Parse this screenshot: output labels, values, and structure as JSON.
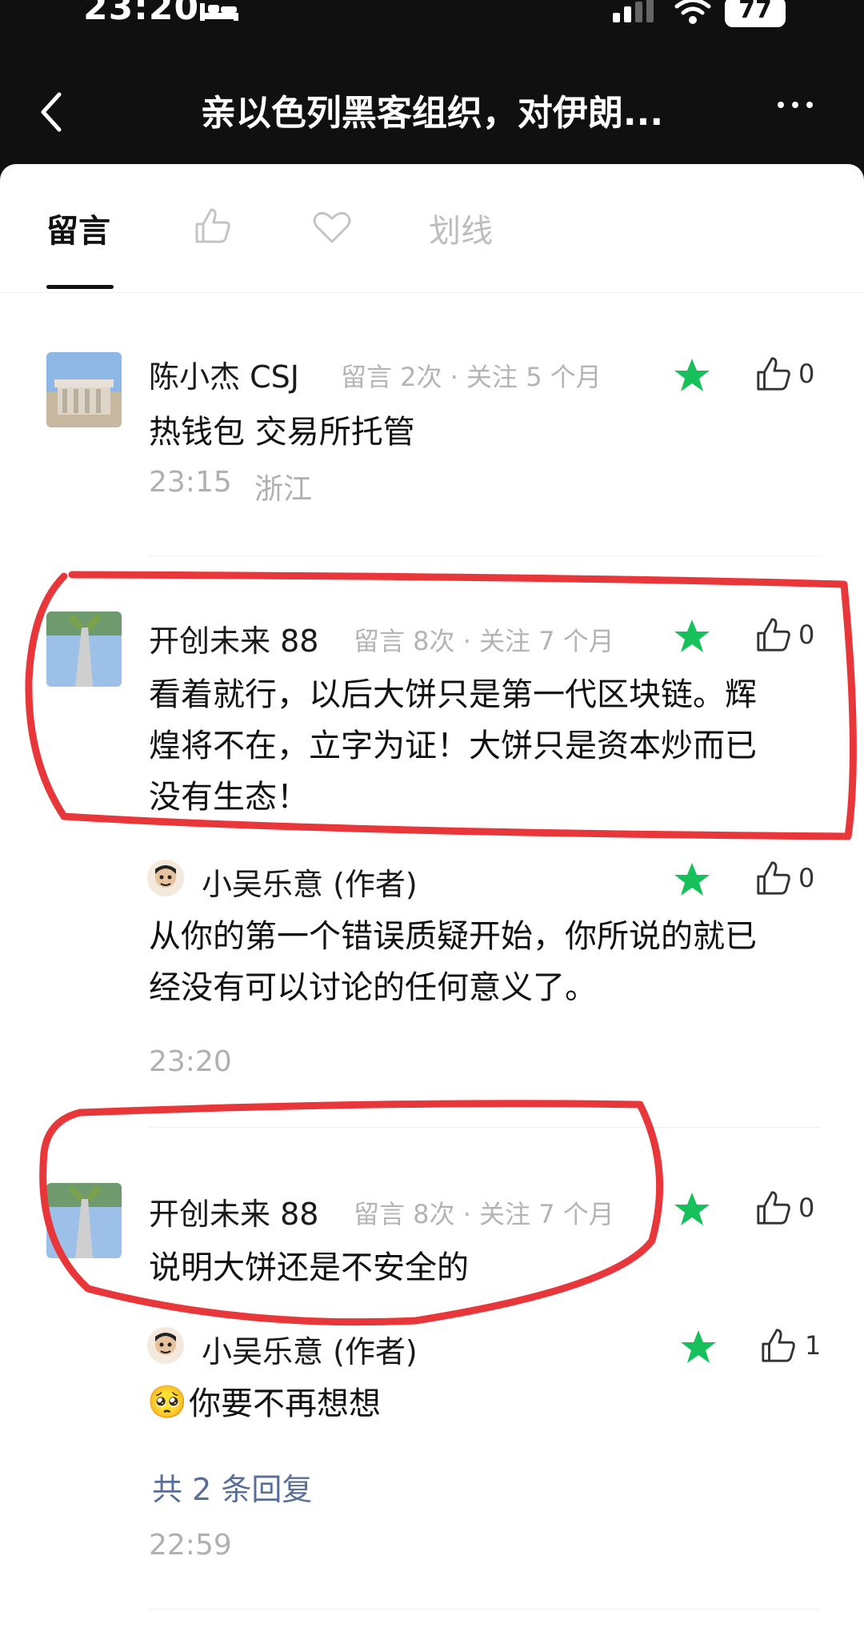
{
  "status": {
    "time": "23:20",
    "battery": "77"
  },
  "nav": {
    "title": "亲以色列黑客组织，对伊朗..."
  },
  "tabs": [
    {
      "label": "留言"
    },
    {
      "icon": "thumbs-up-icon"
    },
    {
      "icon": "heart-icon"
    },
    {
      "label": "划线"
    }
  ],
  "comments": [
    {
      "author": "陈小杰 CSJ",
      "meta": "留言 2次 · 关注 5 个月",
      "text": "热钱包 交易所托管",
      "time": "23:15",
      "location": "浙江",
      "likes": "0"
    },
    {
      "author": "开创未来 88",
      "meta": "留言 8次 · 关注 7 个月",
      "text_lines": [
        "看着就行，以后大饼只是第一代区块链。辉",
        "煌将不在，立字为证！大饼只是资本炒而已",
        "没有生态！"
      ],
      "likes": "0",
      "reply": {
        "author": "小吴乐意 (作者)",
        "text_lines": [
          "从你的第一个错误质疑开始，你所说的就已",
          "经没有可以讨论的任何意义了。"
        ],
        "likes": "0"
      },
      "time": "23:20"
    },
    {
      "author": "开创未来 88",
      "meta": "留言 8次 · 关注 7 个月",
      "text": "说明大饼还是不安全的",
      "likes": "0",
      "reply": {
        "author": "小吴乐意 (作者)",
        "emoji": "🥺",
        "text": "你要不再想想",
        "likes": "1"
      },
      "reply_count": "共 2 条回复",
      "time": "22:59"
    }
  ],
  "colors": {
    "star": "#17c05b",
    "annotation": "#e8373b",
    "link": "#5a6f97"
  }
}
